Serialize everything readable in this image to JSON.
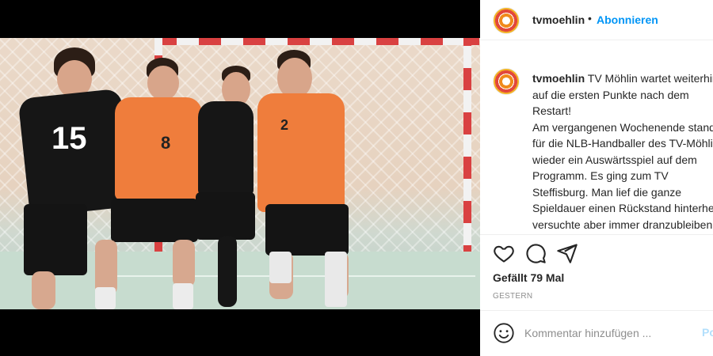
{
  "post": {
    "username": "tvmoehlin",
    "separator": "•",
    "follow_label": "Abonnieren",
    "caption_user": "tvmoehlin",
    "caption_text": " TV Möhlin wartet weiterhin\nauf die ersten Punkte nach dem\nRestart!\nAm vergangenen Wochenende stand\nfür die NLB-Handballer des TV-Möhlin\nwieder ein Auswärtsspiel auf dem\nProgramm. Es ging zum TV\nSteffisburg. Man lief die ganze\nSpieldauer einen Rückstand hinterher,\nversuchte aber immer dranzubleiben.\nDie Berner Oberländer liessen sich",
    "likes": "Gefällt 79 Mal",
    "date": "GESTERN",
    "comment_placeholder": "Kommentar hinzufügen ...",
    "post_label": "Posten"
  },
  "photo": {
    "jersey_numbers": [
      "15",
      "8",
      "2"
    ]
  },
  "icons": {
    "like": "heart-icon",
    "comment": "comment-icon",
    "share": "share-icon",
    "emoji": "smiley-icon"
  },
  "colors": {
    "accent": "#0095f6",
    "orange_jersey": "#ef7d3c",
    "black_jersey": "#161616"
  }
}
